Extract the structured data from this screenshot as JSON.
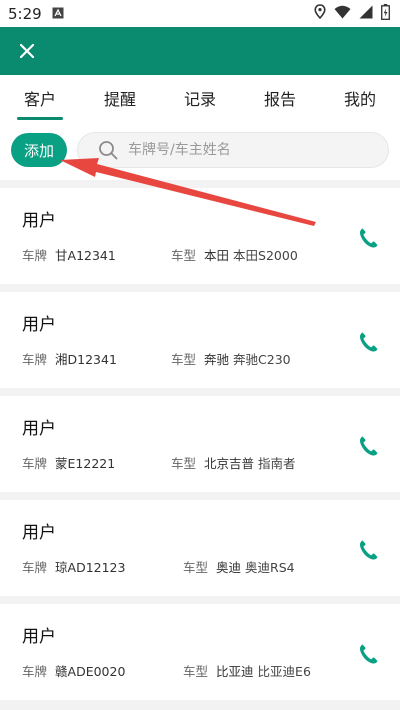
{
  "status": {
    "time": "5:29"
  },
  "tabs": [
    {
      "label": "客户",
      "active": true
    },
    {
      "label": "提醒"
    },
    {
      "label": "记录"
    },
    {
      "label": "报告"
    },
    {
      "label": "我的"
    }
  ],
  "toolbar": {
    "add_label": "添加",
    "search_placeholder": "车牌号/车主姓名"
  },
  "labels": {
    "plate": "车牌",
    "type": "车型"
  },
  "customers": [
    {
      "name": "用户",
      "plate": "甘A12341",
      "brand": "本田",
      "model": "本田S2000"
    },
    {
      "name": "用户",
      "plate": "湘D12341",
      "brand": "奔驰",
      "model": "奔驰C230"
    },
    {
      "name": "用户",
      "plate": "蒙E12221",
      "brand": "北京吉普",
      "model": "指南者"
    },
    {
      "name": "用户",
      "plate": "琼AD12123",
      "brand": "奥迪",
      "model": "奥迪RS4"
    },
    {
      "name": "用户",
      "plate": "赣ADE0020",
      "brand": "比亚迪",
      "model": "比亚迪E6"
    }
  ],
  "colors": {
    "primary": "#0a8a6f",
    "accent": "#0aa083",
    "arrow": "#e8473f"
  },
  "icons": {
    "close": "close-icon",
    "search": "search-icon",
    "phone": "phone-icon"
  }
}
